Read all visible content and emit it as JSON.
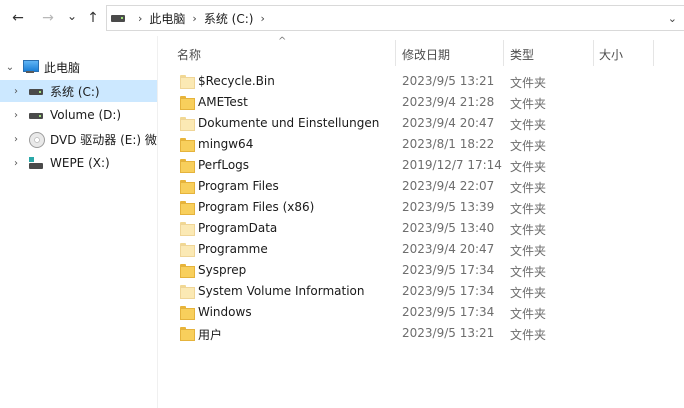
{
  "nav": {
    "back_icon": "arrow-left-icon",
    "forward_icon": "arrow-right-icon",
    "history_icon": "chevron-down-icon",
    "up_icon": "arrow-up-icon",
    "back": "←",
    "forward": "→",
    "history": "⌄",
    "up": "↑"
  },
  "address": {
    "sep": "›",
    "crumbs": [
      "此电脑",
      "系统 (C:)"
    ],
    "expand": "⌄"
  },
  "sidebar": {
    "expand_open": "⌄",
    "expand_closed": "›",
    "root": {
      "label": "此电脑",
      "icon": "computer-icon"
    },
    "items": [
      {
        "label": "系统 (C:)",
        "icon": "hard-drive-icon",
        "selected": true
      },
      {
        "label": "Volume (D:)",
        "icon": "hard-drive-icon",
        "selected": false
      },
      {
        "label": "DVD 驱动器 (E:) 微",
        "icon": "dvd-drive-icon",
        "selected": false
      },
      {
        "label": "WEPE (X:)",
        "icon": "network-drive-icon",
        "selected": false
      }
    ]
  },
  "columns": {
    "sort_indicator": "^",
    "name": "名称",
    "date": "修改日期",
    "type": "类型",
    "size": "大小"
  },
  "files": [
    {
      "name": "$Recycle.Bin",
      "date": "2023/9/5 13:21",
      "type": "文件夹",
      "hidden": true
    },
    {
      "name": "AMETest",
      "date": "2023/9/4 21:28",
      "type": "文件夹",
      "hidden": false
    },
    {
      "name": "Dokumente und Einstellungen",
      "date": "2023/9/4 20:47",
      "type": "文件夹",
      "hidden": true
    },
    {
      "name": "mingw64",
      "date": "2023/8/1 18:22",
      "type": "文件夹",
      "hidden": false
    },
    {
      "name": "PerfLogs",
      "date": "2019/12/7 17:14",
      "type": "文件夹",
      "hidden": false
    },
    {
      "name": "Program Files",
      "date": "2023/9/4 22:07",
      "type": "文件夹",
      "hidden": false
    },
    {
      "name": "Program Files (x86)",
      "date": "2023/9/5 13:39",
      "type": "文件夹",
      "hidden": false
    },
    {
      "name": "ProgramData",
      "date": "2023/9/5 13:40",
      "type": "文件夹",
      "hidden": true
    },
    {
      "name": "Programme",
      "date": "2023/9/4 20:47",
      "type": "文件夹",
      "hidden": true
    },
    {
      "name": "Sysprep",
      "date": "2023/9/5 17:34",
      "type": "文件夹",
      "hidden": false
    },
    {
      "name": "System Volume Information",
      "date": "2023/9/5 17:34",
      "type": "文件夹",
      "hidden": true
    },
    {
      "name": "Windows",
      "date": "2023/9/5 17:34",
      "type": "文件夹",
      "hidden": false
    },
    {
      "name": "用户",
      "date": "2023/9/5 13:21",
      "type": "文件夹",
      "hidden": false
    }
  ],
  "colors": {
    "selection": "#cce8ff",
    "folder": "#f8cf5c",
    "folder_hidden": "#fbe9b4"
  }
}
